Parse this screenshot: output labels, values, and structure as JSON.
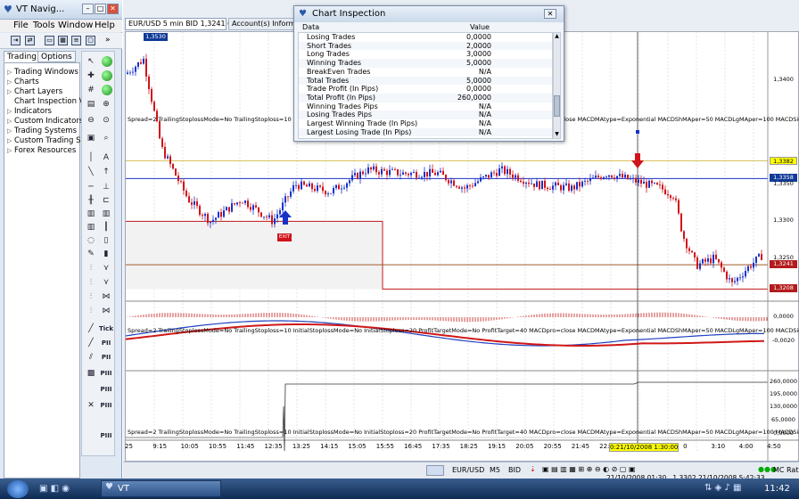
{
  "nav_window": {
    "title": "VT Navig...",
    "minimize": "–",
    "restore": "□",
    "close": "✕",
    "menu": [
      "File",
      "Tools",
      "Window",
      "Help"
    ],
    "tabs": [
      "Trading",
      "Options"
    ],
    "tree": [
      "Trading Windows",
      "Charts",
      "Chart Layers",
      "Chart Inspection V",
      "Indicators",
      "Custom Indicators",
      "Trading Systems",
      "Custom Trading S",
      "Forex Resources"
    ],
    "tool_labels": [
      "Tick",
      "PII",
      "PII",
      "PIII",
      "PIII",
      "PIII",
      "PIII"
    ]
  },
  "chart": {
    "doc_tab": "EUR/USD 5 min BID 1,3241 05:45:00 High 1,390",
    "tab2": "Account(s) Informati",
    "header_small": "1,3530",
    "price_labels": [
      {
        "label": "1,3382",
        "style": "y",
        "v": 1.3382
      },
      {
        "label": "1,3358",
        "style": "b",
        "v": 1.3358
      },
      {
        "label": "1,3350",
        "style": "plain",
        "v": 1.335
      },
      {
        "label": "1,3300",
        "style": "plain",
        "v": 1.33
      },
      {
        "label": "1,3250",
        "style": "plain",
        "v": 1.325
      },
      {
        "label": "1,3241",
        "style": "r",
        "v": 1.3241
      },
      {
        "label": "1,3208",
        "style": "r",
        "v": 1.3208
      },
      {
        "label": "1,3400",
        "style": "plain",
        "v": 1.34
      }
    ],
    "ind1_labels": [
      "0,0000",
      "-0,0020"
    ],
    "ind2_labels": [
      "260,0000",
      "195,0000",
      "130,0000",
      "65,0000",
      "0,0000"
    ],
    "subtitle_main": "Spread=2 TrailingStoplossMode=No TrailingStoploss=10 InitialStoplossMode=No InitialStoploss=20 ProfitTargetMode=No ProfitTarget=40 MACDpro=close MACDMAtype=Exponential MACDShMAper=50 MACDLgMAper=100 MACDSigMAper=18",
    "subtitle_ind": "Spread=2 TrailingStoplossMode=No TrailingStoploss=10 InitialStoplossMode=No InitialStoploss=20 ProfitTargetMode=No ProfitTarget=40 MACDpro=close MACDMAtype=Exponential MACDShMAper=50 MACDLgMAper=100 MACDSigMAper=18",
    "subtitle_eq": "Spread=2 TrailingStoplossMode=No TrailingStoploss=10 InitialStoplossMode=No InitialStoploss=20 ProfitTargetMode=No ProfitTarget=40 MACDpro=close MACDMAtype=Exponential MACDShMAper=50 MACDLgMAper=100 MACDSigMAper=18",
    "time_labels": [
      "25",
      "9:15",
      "10:05",
      "10:55",
      "11:45",
      "12:35",
      "13:25",
      "14:15",
      "15:05",
      "15:55",
      "16:45",
      "17:35",
      "18:25",
      "19:15",
      "20:05",
      "20:55",
      "21:45",
      "22:35",
      "23:25 oct.21",
      "0:21/10/2008 1:30:00",
      "0",
      "3:10",
      "4:00",
      "4:50"
    ],
    "exit_badge": "EXIT"
  },
  "inspector": {
    "title": "Chart Inspection",
    "close": "✕",
    "col_data": "Data",
    "col_value": "Value",
    "rows": [
      {
        "k": "Losing Trades",
        "v": "0,0000"
      },
      {
        "k": "Short Trades",
        "v": "2,0000"
      },
      {
        "k": "Long Trades",
        "v": "3,0000"
      },
      {
        "k": "Winning Trades",
        "v": "5,0000"
      },
      {
        "k": "BreakEven Trades",
        "v": "N/A"
      },
      {
        "k": "Total Trades",
        "v": "5,0000"
      },
      {
        "k": "Trade Profit (In Pips)",
        "v": "0,0000"
      },
      {
        "k": "Total Profit (In Pips)",
        "v": "260,0000"
      },
      {
        "k": "Winning Trades Pips",
        "v": "N/A"
      },
      {
        "k": "Losing Trades Pips",
        "v": "N/A"
      },
      {
        "k": "Largest Winning Trade (In Pips)",
        "v": "N/A"
      },
      {
        "k": "Largest Losing Trade (In Pips)",
        "v": "N/A"
      }
    ]
  },
  "statusbar": {
    "symbol": "EUR/USD",
    "period": "M5",
    "side": "BID",
    "status_text": "21/10/2008 01:30 , 1,3302  21/10/2008 5:42:33",
    "rates": "MC Rates"
  },
  "taskbar": {
    "app": "VT",
    "clock": "11:42"
  },
  "colors": {
    "bull": "#1832c8",
    "bear": "#d0141a",
    "macd_fast": "#2040c0",
    "macd_slow": "#d01818"
  }
}
